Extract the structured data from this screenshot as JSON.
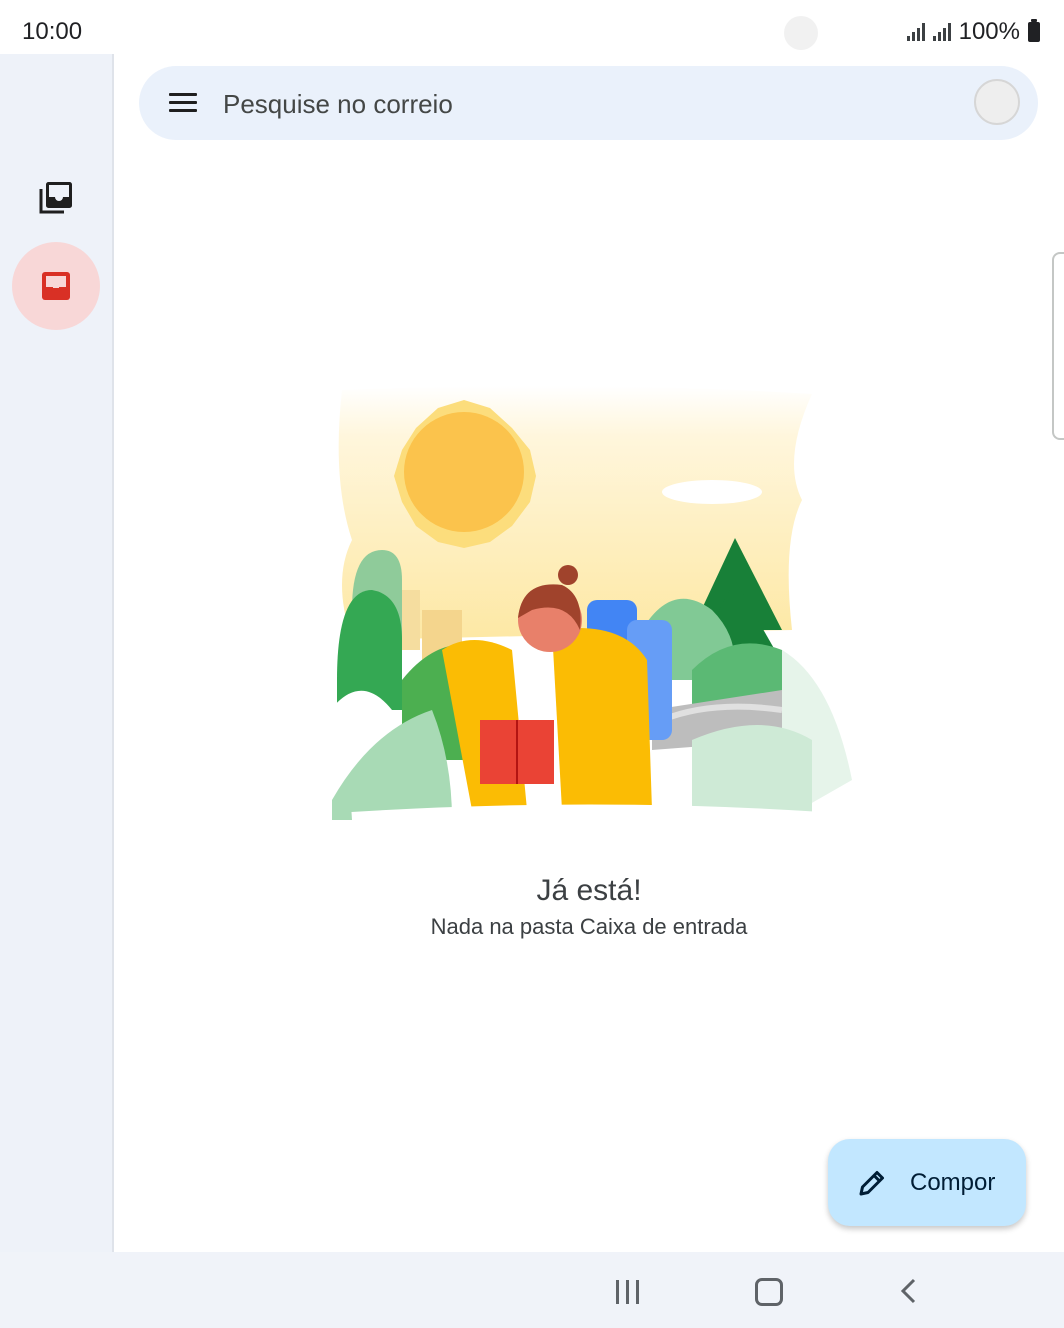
{
  "status_bar": {
    "time": "10:00",
    "battery": "100%"
  },
  "rail": {
    "all_mail_icon": "all-mail-icon",
    "inbox_icon": "inbox-icon",
    "accent": "#d93025",
    "active_bg": "#f8d7d7"
  },
  "search": {
    "placeholder": "Pesquise no correio"
  },
  "empty_state": {
    "title": "Já está!",
    "subtitle": "Nada na pasta Caixa de entrada"
  },
  "compose": {
    "label": "Compor",
    "icon": "pencil-icon",
    "bg": "#c2e7ff"
  },
  "nav": {
    "recents_icon": "recents-icon",
    "home_icon": "home-icon",
    "back_icon": "back-icon"
  }
}
